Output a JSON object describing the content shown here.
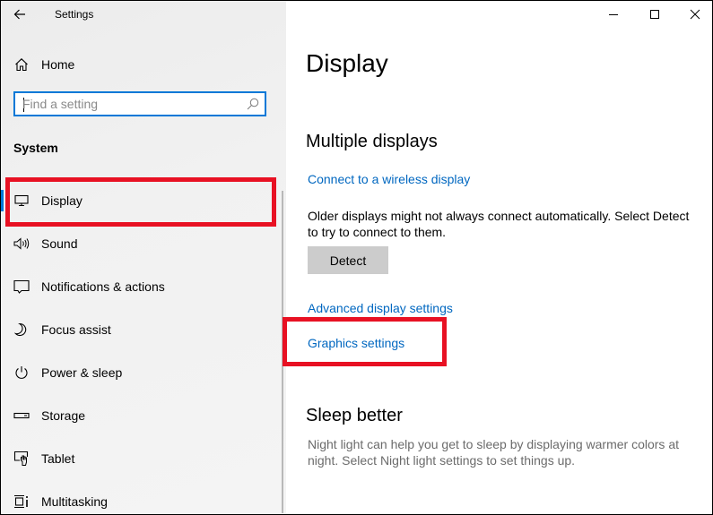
{
  "window": {
    "app_title": "Settings",
    "controls": {
      "minimize": "minimize-icon",
      "maximize": "maximize-icon",
      "close": "close-icon"
    }
  },
  "sidebar": {
    "back_icon": "back-arrow-icon",
    "home": {
      "label": "Home",
      "icon": "home-icon"
    },
    "search": {
      "placeholder": "Find a setting",
      "value": "",
      "icon": "search-icon"
    },
    "section_header": "System",
    "items": [
      {
        "label": "Display",
        "icon": "monitor-icon",
        "selected": true,
        "highlighted": true
      },
      {
        "label": "Sound",
        "icon": "speaker-icon"
      },
      {
        "label": "Notifications & actions",
        "icon": "notification-icon"
      },
      {
        "label": "Focus assist",
        "icon": "moon-icon"
      },
      {
        "label": "Power & sleep",
        "icon": "power-icon"
      },
      {
        "label": "Storage",
        "icon": "storage-icon"
      },
      {
        "label": "Tablet",
        "icon": "tablet-icon"
      },
      {
        "label": "Multitasking",
        "icon": "multitasking-icon"
      }
    ]
  },
  "main": {
    "page_title": "Display",
    "multiple_displays": {
      "heading": "Multiple displays",
      "wireless_link": "Connect to a wireless display",
      "description": "Older displays might not always connect automatically. Select Detect to try to connect to them.",
      "detect_button": "Detect",
      "advanced_link": "Advanced display settings",
      "graphics_link": "Graphics settings"
    },
    "sleep_better": {
      "heading": "Sleep better",
      "description": "Night light can help you get to sleep by displaying warmer colors at night. Select Night light settings to set things up."
    }
  },
  "annotations": {
    "highlight_color": "#e81123",
    "highlighted_targets": [
      "Display",
      "Graphics settings"
    ]
  },
  "colors": {
    "accent": "#0078d7",
    "link": "#0067c0",
    "button_bg": "#cccccc"
  }
}
